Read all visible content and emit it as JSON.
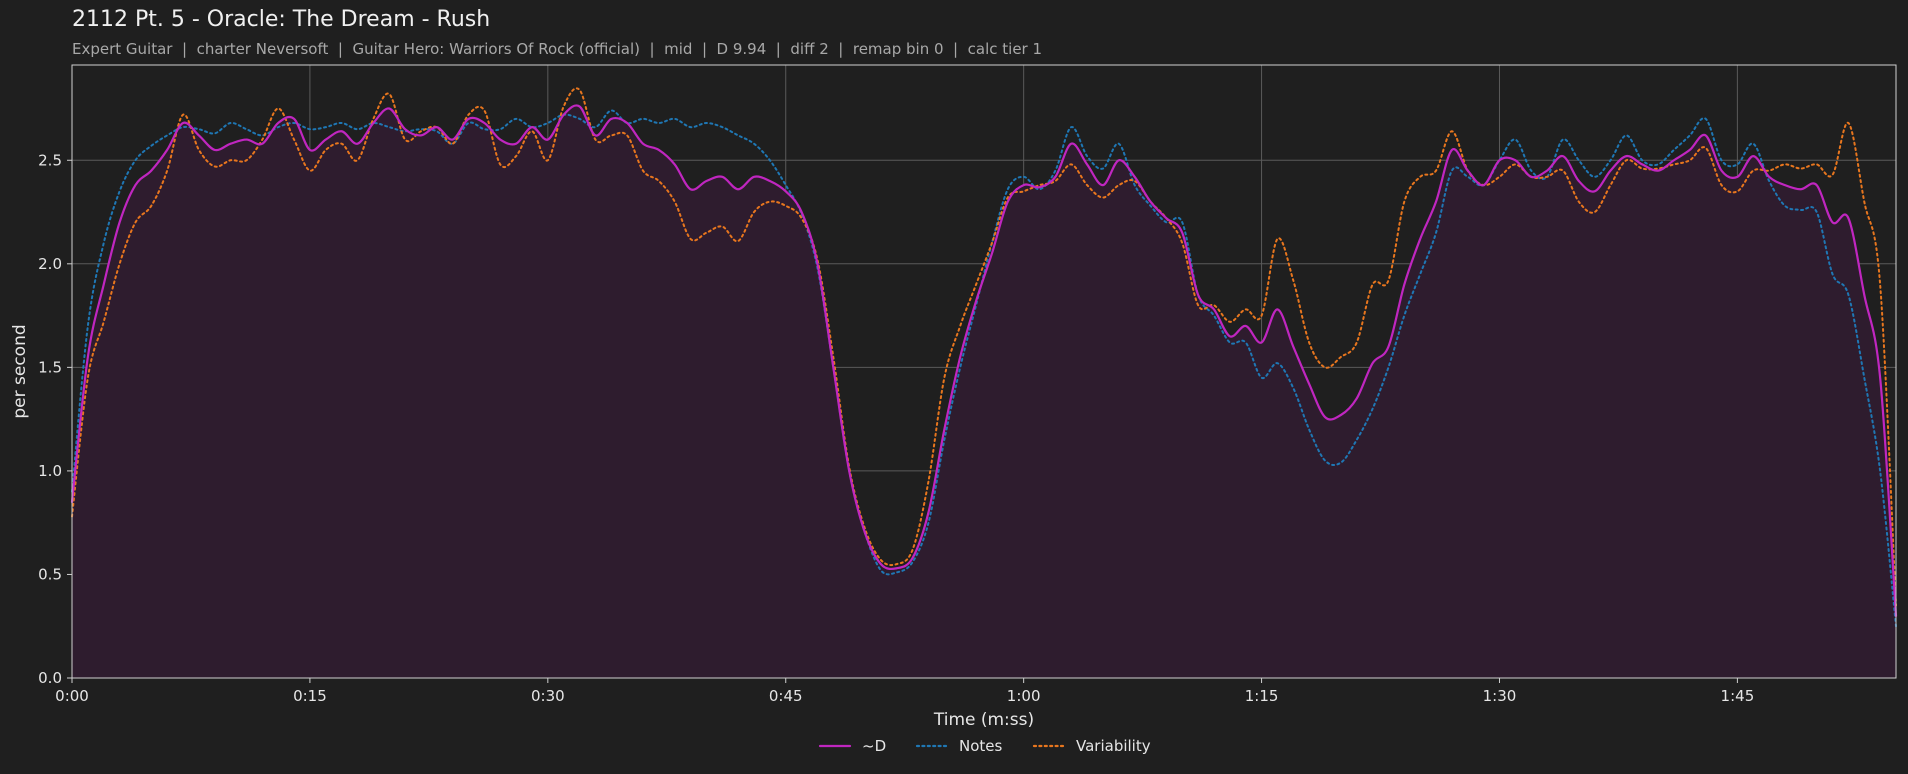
{
  "header": {
    "title": "2112 Pt. 5 - Oracle: The Dream - Rush",
    "subtitle": "Expert Guitar  |  charter Neversoft  |  Guitar Hero: Warriors Of Rock (official)  |  mid  |  D 9.94  |  diff 2  |  remap bin 0  |  calc tier 1"
  },
  "colors": {
    "background": "#1f1f1f",
    "plot_bg": "#1f1f1f",
    "grid": "#5a5a5a",
    "fill": "#2e1c2e",
    "d_line": "#c026c0",
    "notes_line": "#1f77b4",
    "variability_line": "#e8761e"
  },
  "chart_data": {
    "type": "line",
    "xlabel": "Time (m:ss)",
    "ylabel": "per second",
    "xlim": [
      0,
      115
    ],
    "ylim": [
      0,
      2.96
    ],
    "x_ticks": [
      0,
      15,
      30,
      45,
      60,
      75,
      90,
      105
    ],
    "x_tick_labels": [
      "0:00",
      "0:15",
      "0:30",
      "0:45",
      "1:00",
      "1:15",
      "1:30",
      "1:45"
    ],
    "y_ticks": [
      0.0,
      0.5,
      1.0,
      1.5,
      2.0,
      2.5
    ],
    "y_tick_labels": [
      "0.0",
      "0.5",
      "1.0",
      "1.5",
      "2.0",
      "2.5"
    ],
    "grid": true,
    "legend_position": "bottom-center",
    "x": [
      0,
      1,
      2,
      3,
      4,
      5,
      6,
      7,
      8,
      9,
      10,
      11,
      12,
      13,
      14,
      15,
      16,
      17,
      18,
      19,
      20,
      21,
      22,
      23,
      24,
      25,
      26,
      27,
      28,
      29,
      30,
      31,
      32,
      33,
      34,
      35,
      36,
      37,
      38,
      39,
      40,
      41,
      42,
      43,
      44,
      45,
      46,
      47,
      48,
      49,
      50,
      51,
      52,
      53,
      54,
      55,
      56,
      57,
      58,
      59,
      60,
      61,
      62,
      63,
      64,
      65,
      66,
      67,
      68,
      69,
      70,
      71,
      72,
      73,
      74,
      75,
      76,
      77,
      78,
      79,
      80,
      81,
      82,
      83,
      84,
      85,
      86,
      87,
      88,
      89,
      90,
      91,
      92,
      93,
      94,
      95,
      96,
      97,
      98,
      99,
      100,
      101,
      102,
      103,
      104,
      105,
      106,
      107,
      108,
      109,
      110,
      111,
      112,
      113,
      114,
      115
    ],
    "series": [
      {
        "name": "~D",
        "style": "solid",
        "values": [
          0.85,
          1.55,
          1.9,
          2.2,
          2.38,
          2.45,
          2.55,
          2.68,
          2.62,
          2.55,
          2.58,
          2.6,
          2.58,
          2.68,
          2.7,
          2.55,
          2.6,
          2.64,
          2.58,
          2.68,
          2.75,
          2.65,
          2.62,
          2.66,
          2.6,
          2.7,
          2.68,
          2.6,
          2.58,
          2.66,
          2.6,
          2.72,
          2.76,
          2.62,
          2.7,
          2.68,
          2.58,
          2.55,
          2.48,
          2.36,
          2.4,
          2.42,
          2.36,
          2.42,
          2.4,
          2.35,
          2.25,
          2.0,
          1.5,
          1.0,
          0.7,
          0.55,
          0.53,
          0.58,
          0.8,
          1.2,
          1.55,
          1.82,
          2.05,
          2.3,
          2.38,
          2.37,
          2.42,
          2.58,
          2.48,
          2.38,
          2.5,
          2.42,
          2.3,
          2.22,
          2.15,
          1.85,
          1.78,
          1.65,
          1.7,
          1.62,
          1.78,
          1.6,
          1.42,
          1.26,
          1.27,
          1.35,
          1.52,
          1.6,
          1.9,
          2.12,
          2.3,
          2.55,
          2.45,
          2.38,
          2.5,
          2.5,
          2.42,
          2.45,
          2.52,
          2.4,
          2.35,
          2.45,
          2.52,
          2.48,
          2.45,
          2.5,
          2.55,
          2.62,
          2.45,
          2.42,
          2.52,
          2.42,
          2.38,
          2.36,
          2.38,
          2.2,
          2.22,
          1.85,
          1.45,
          0.3
        ]
      },
      {
        "name": "Notes",
        "style": "dotted",
        "values": [
          0.9,
          1.7,
          2.1,
          2.35,
          2.5,
          2.57,
          2.62,
          2.66,
          2.65,
          2.63,
          2.68,
          2.65,
          2.62,
          2.66,
          2.68,
          2.65,
          2.66,
          2.68,
          2.65,
          2.68,
          2.66,
          2.64,
          2.65,
          2.64,
          2.58,
          2.68,
          2.65,
          2.65,
          2.7,
          2.66,
          2.68,
          2.72,
          2.7,
          2.66,
          2.74,
          2.68,
          2.7,
          2.68,
          2.7,
          2.66,
          2.68,
          2.66,
          2.62,
          2.58,
          2.5,
          2.38,
          2.24,
          1.98,
          1.5,
          1.0,
          0.7,
          0.52,
          0.51,
          0.56,
          0.75,
          1.15,
          1.5,
          1.8,
          2.1,
          2.36,
          2.42,
          2.36,
          2.45,
          2.66,
          2.52,
          2.46,
          2.58,
          2.38,
          2.28,
          2.2,
          2.2,
          1.85,
          1.75,
          1.62,
          1.62,
          1.45,
          1.52,
          1.4,
          1.2,
          1.05,
          1.04,
          1.15,
          1.3,
          1.5,
          1.75,
          1.95,
          2.15,
          2.45,
          2.42,
          2.38,
          2.5,
          2.6,
          2.45,
          2.42,
          2.6,
          2.5,
          2.42,
          2.5,
          2.62,
          2.5,
          2.48,
          2.55,
          2.62,
          2.7,
          2.5,
          2.48,
          2.58,
          2.4,
          2.28,
          2.26,
          2.25,
          1.95,
          1.85,
          1.45,
          1.0,
          0.25
        ]
      },
      {
        "name": "Variability",
        "style": "dotted",
        "values": [
          0.78,
          1.45,
          1.72,
          2.0,
          2.2,
          2.28,
          2.45,
          2.72,
          2.55,
          2.47,
          2.5,
          2.5,
          2.6,
          2.75,
          2.6,
          2.45,
          2.55,
          2.58,
          2.5,
          2.7,
          2.82,
          2.6,
          2.64,
          2.66,
          2.58,
          2.72,
          2.74,
          2.48,
          2.52,
          2.64,
          2.5,
          2.76,
          2.84,
          2.6,
          2.62,
          2.62,
          2.45,
          2.4,
          2.3,
          2.12,
          2.15,
          2.18,
          2.11,
          2.25,
          2.3,
          2.28,
          2.22,
          2.02,
          1.55,
          1.02,
          0.72,
          0.57,
          0.55,
          0.62,
          0.95,
          1.45,
          1.7,
          1.9,
          2.1,
          2.32,
          2.35,
          2.38,
          2.4,
          2.48,
          2.38,
          2.32,
          2.38,
          2.4,
          2.3,
          2.22,
          2.1,
          1.8,
          1.8,
          1.72,
          1.78,
          1.75,
          2.12,
          1.92,
          1.62,
          1.5,
          1.55,
          1.62,
          1.9,
          1.92,
          2.3,
          2.42,
          2.45,
          2.64,
          2.45,
          2.38,
          2.42,
          2.48,
          2.42,
          2.42,
          2.45,
          2.3,
          2.25,
          2.38,
          2.5,
          2.46,
          2.46,
          2.48,
          2.5,
          2.56,
          2.38,
          2.35,
          2.45,
          2.45,
          2.48,
          2.46,
          2.48,
          2.43,
          2.68,
          2.3,
          1.9,
          0.35
        ]
      }
    ]
  }
}
